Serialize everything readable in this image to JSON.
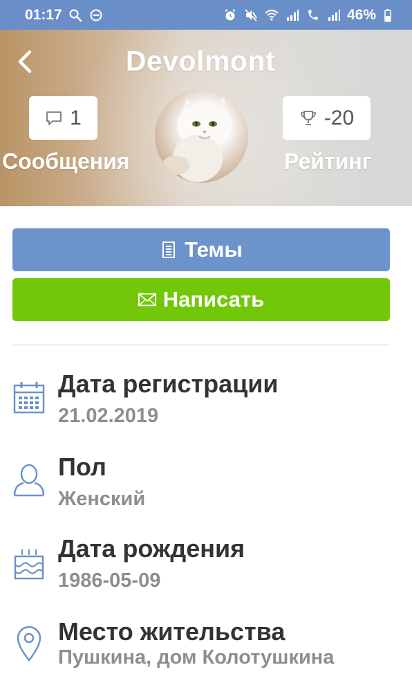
{
  "status_bar": {
    "time": "01:17",
    "battery": "46%"
  },
  "header": {
    "title": "Devolmont",
    "messages_count": "1",
    "messages_label": "Сообщения",
    "rating_value": "-20",
    "rating_label": "Рейтинг"
  },
  "buttons": {
    "topics_label": "Темы",
    "write_label": "Написать"
  },
  "info": [
    {
      "label": "Дата регистрации",
      "value": "21.02.2019",
      "icon": "calendar-icon"
    },
    {
      "label": "Пол",
      "value": "Женский",
      "icon": "user-icon"
    },
    {
      "label": "Дата рождения",
      "value": "1986-05-09",
      "icon": "birthday-cake-icon"
    },
    {
      "label": "Место жительства",
      "value": "Пушкина, дом Колотушкина",
      "icon": "location-pin-icon"
    }
  ],
  "colors": {
    "status_bar": "#6a8fc8",
    "topics_button": "#6d93cd",
    "write_button": "#73c709",
    "icon_blue": "#6b93c9"
  }
}
